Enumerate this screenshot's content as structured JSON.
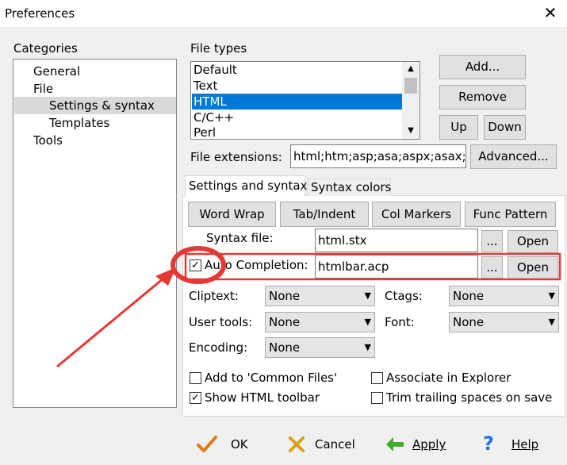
{
  "window": {
    "title": "Preferences"
  },
  "categories": {
    "label": "Categories",
    "items": [
      {
        "label": "General",
        "level": 1
      },
      {
        "label": "File",
        "level": 1
      },
      {
        "label": "Settings & syntax",
        "level": 2,
        "selected": true
      },
      {
        "label": "Templates",
        "level": 2
      },
      {
        "label": "Tools",
        "level": 1
      }
    ]
  },
  "file_types": {
    "label": "File types",
    "items": [
      "Default",
      "Text",
      "HTML",
      "C/C++",
      "Perl"
    ],
    "selected": "HTML",
    "buttons": {
      "add": "Add...",
      "remove": "Remove",
      "up": "Up",
      "down": "Down"
    }
  },
  "file_extensions": {
    "label": "File extensions:",
    "value": "html;htm;asp;asa;aspx;asax;sh",
    "advanced": "Advanced..."
  },
  "tabs": [
    {
      "label": "Settings and syntax",
      "active": true
    },
    {
      "label": "Syntax colors",
      "active": false
    }
  ],
  "settings": {
    "buttons": {
      "word_wrap": "Word Wrap",
      "tab_indent": "Tab/Indent",
      "col_markers": "Col Markers",
      "func_pattern": "Func Pattern"
    },
    "syntax_file": {
      "label": "Syntax file:",
      "value": "html.stx",
      "browse": "...",
      "open": "Open"
    },
    "auto_completion": {
      "label": "Auto Completion:",
      "value": "htmlbar.acp",
      "browse": "...",
      "open": "Open",
      "checked": true
    },
    "cliptext": {
      "label": "Cliptext:",
      "value": "None"
    },
    "ctags": {
      "label": "Ctags:",
      "value": "None"
    },
    "user_tools": {
      "label": "User tools:",
      "value": "None"
    },
    "font": {
      "label": "Font:",
      "value": "None"
    },
    "encoding": {
      "label": "Encoding:",
      "value": "None"
    },
    "checkboxes": {
      "add_common": {
        "label": "Add to 'Common Files'",
        "checked": false
      },
      "associate_explorer": {
        "label": "Associate in Explorer",
        "checked": false
      },
      "show_html_toolbar": {
        "label": "Show HTML toolbar",
        "checked": true
      },
      "trim_trailing": {
        "label": "Trim trailing spaces on save",
        "checked": false
      }
    }
  },
  "footer": {
    "ok": "OK",
    "cancel": "Cancel",
    "apply": "Apply",
    "help": "Help"
  },
  "annotation_color": "#e53935"
}
